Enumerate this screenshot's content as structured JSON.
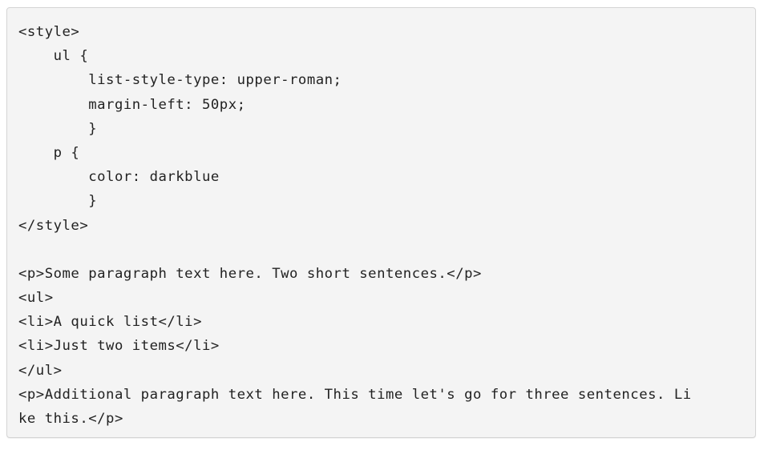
{
  "code_block": {
    "lines": [
      "<style>",
      "    ul {",
      "        list-style-type: upper-roman;",
      "        margin-left: 50px;",
      "        }",
      "    p {",
      "        color: darkblue",
      "        }",
      "</style>",
      "",
      "<p>Some paragraph text here. Two short sentences.</p>",
      "<ul>",
      "<li>A quick list</li>",
      "<li>Just two items</li>",
      "</ul>",
      "<p>Additional paragraph text here. This time let's go for three sentences. Li",
      "ke this.</p>"
    ]
  }
}
